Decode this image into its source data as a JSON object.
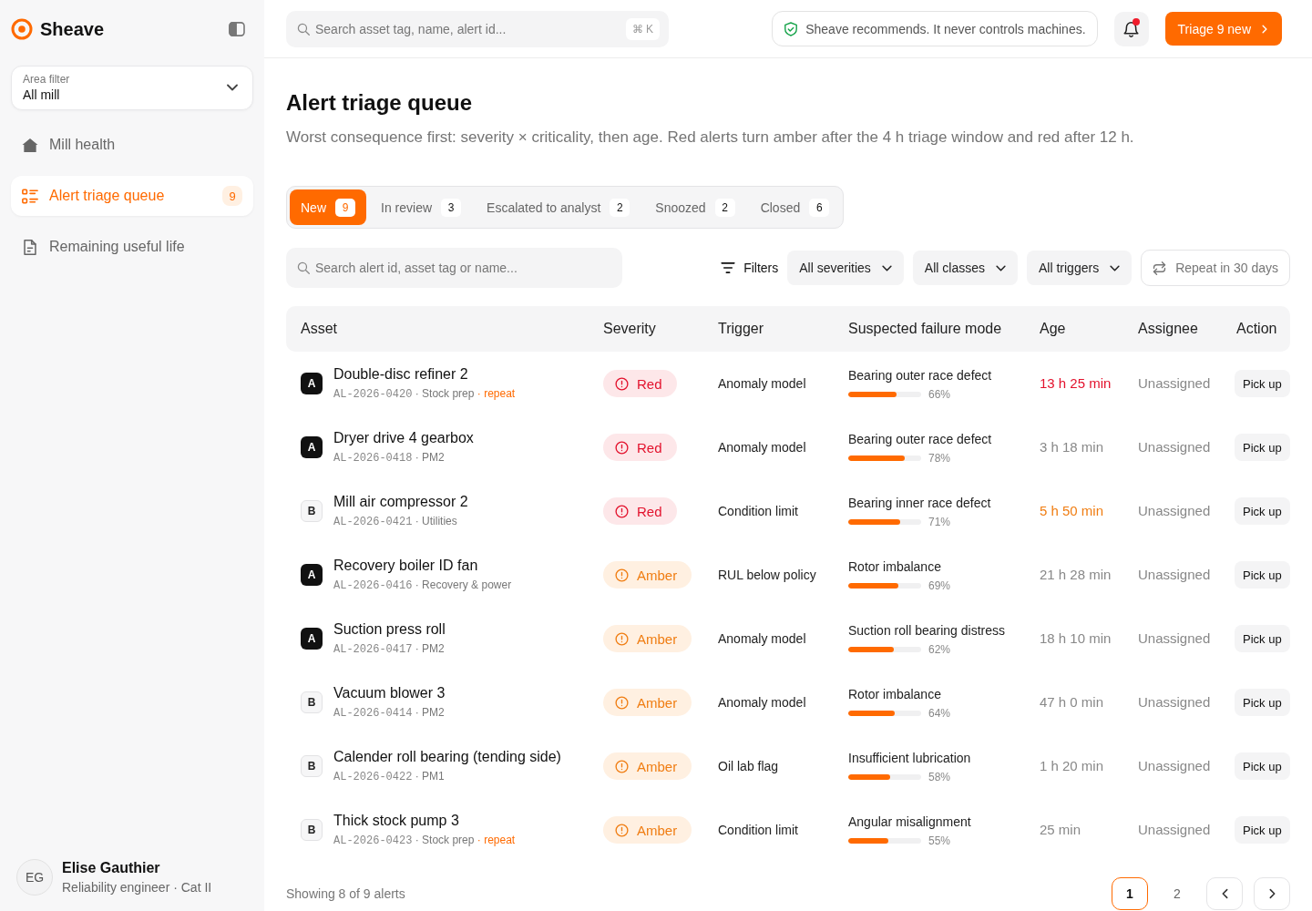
{
  "sidebar": {
    "brand": "Sheave",
    "area_filter": {
      "label": "Area filter",
      "value": "All mill"
    },
    "nav": [
      {
        "label": "Mill health",
        "selected": false
      },
      {
        "label": "Alert triage queue",
        "selected": true,
        "count": "9"
      },
      {
        "label": "Remaining useful life",
        "selected": false
      }
    ],
    "user": {
      "initials": "EG",
      "name": "Elise Gauthier",
      "role": "Reliability engineer · Cat II"
    }
  },
  "topbar": {
    "search": {
      "placeholder": "Search asset tag, name, alert id...",
      "shortcut": "⌘ K"
    },
    "notice": "Sheave recommends. It never controls machines.",
    "notifications": {
      "unread": true
    },
    "primary_action": "Triage 9 new"
  },
  "page": {
    "title": "Alert triage queue",
    "subtitle": "Worst consequence first: severity × criticality, then age. Red alerts turn amber after the 4 h triage window and red after 12 h."
  },
  "tabs": [
    {
      "label": "New",
      "count": "9",
      "selected": true
    },
    {
      "label": "In review",
      "count": "3",
      "selected": false
    },
    {
      "label": "Escalated to analyst",
      "count": "2",
      "selected": false
    },
    {
      "label": "Snoozed",
      "count": "2",
      "selected": false
    },
    {
      "label": "Closed",
      "count": "6",
      "selected": false
    }
  ],
  "filters": {
    "search": {
      "placeholder": "Search alert id, asset tag or name..."
    },
    "filter_button": "Filters",
    "dropdowns": [
      "All severities",
      "All classes",
      "All triggers"
    ],
    "repeat_toggle": {
      "label": "Repeat in 30 days",
      "on": false
    }
  },
  "table": {
    "columns": [
      "Asset",
      "Severity",
      "Trigger",
      "Suspected failure mode",
      "Age",
      "Assignee",
      "Action"
    ],
    "rows": [
      {
        "criticality": {
          "label": "A",
          "kind": "filled"
        },
        "name": "Double-disc refiner 2",
        "alert_id": "AL-2026-0420",
        "area": "· Stock prep",
        "flag": "· repeat",
        "severity": {
          "label": "Red",
          "kind": "red"
        },
        "trigger": "Anomaly model",
        "failure_mode": {
          "label": "Bearing outer race defect",
          "level": 0.66,
          "reading": "66%"
        },
        "age": {
          "text": "13 h 25 min",
          "kind": "overdue"
        },
        "assignee": "Unassigned",
        "action": "Pick up"
      },
      {
        "criticality": {
          "label": "A",
          "kind": "filled"
        },
        "name": "Dryer drive 4 gearbox",
        "alert_id": "AL-2026-0418",
        "area": "· PM2",
        "severity": {
          "label": "Red",
          "kind": "red"
        },
        "trigger": "Anomaly model",
        "failure_mode": {
          "label": "Bearing outer race defect",
          "level": 0.78,
          "reading": "78%"
        },
        "age": {
          "text": "3 h 18 min",
          "kind": "normal"
        },
        "assignee": "Unassigned",
        "action": "Pick up"
      },
      {
        "criticality": {
          "label": "B",
          "kind": "outlined"
        },
        "name": "Mill air compressor 2",
        "alert_id": "AL-2026-0421",
        "area": "· Utilities",
        "severity": {
          "label": "Red",
          "kind": "red"
        },
        "trigger": "Condition limit",
        "failure_mode": {
          "label": "Bearing inner race defect",
          "level": 0.71,
          "reading": "71%"
        },
        "age": {
          "text": "5 h 50 min",
          "kind": "due_soon"
        },
        "assignee": "Unassigned",
        "action": "Pick up"
      },
      {
        "criticality": {
          "label": "A",
          "kind": "filled"
        },
        "name": "Recovery boiler ID fan",
        "alert_id": "AL-2026-0416",
        "area": "· Recovery & power",
        "severity": {
          "label": "Amber",
          "kind": "amber"
        },
        "trigger": "RUL below policy",
        "failure_mode": {
          "label": "Rotor imbalance",
          "level": 0.69,
          "reading": "69%"
        },
        "age": {
          "text": "21 h 28 min",
          "kind": "normal"
        },
        "assignee": "Unassigned",
        "action": "Pick up"
      },
      {
        "criticality": {
          "label": "A",
          "kind": "filled"
        },
        "name": "Suction press roll",
        "alert_id": "AL-2026-0417",
        "area": "· PM2",
        "severity": {
          "label": "Amber",
          "kind": "amber"
        },
        "trigger": "Anomaly model",
        "failure_mode": {
          "label": "Suction roll bearing distress",
          "level": 0.62,
          "reading": "62%"
        },
        "age": {
          "text": "18 h 10 min",
          "kind": "normal"
        },
        "assignee": "Unassigned",
        "action": "Pick up"
      },
      {
        "criticality": {
          "label": "B",
          "kind": "outlined"
        },
        "name": "Vacuum blower 3",
        "alert_id": "AL-2026-0414",
        "area": "· PM2",
        "severity": {
          "label": "Amber",
          "kind": "amber"
        },
        "trigger": "Anomaly model",
        "failure_mode": {
          "label": "Rotor imbalance",
          "level": 0.64,
          "reading": "64%"
        },
        "age": {
          "text": "47 h 0 min",
          "kind": "normal"
        },
        "assignee": "Unassigned",
        "action": "Pick up"
      },
      {
        "criticality": {
          "label": "B",
          "kind": "outlined"
        },
        "name": "Calender roll bearing (tending side)",
        "alert_id": "AL-2026-0422",
        "area": "· PM1",
        "severity": {
          "label": "Amber",
          "kind": "amber"
        },
        "trigger": "Oil lab flag",
        "failure_mode": {
          "label": "Insufficient lubrication",
          "level": 0.58,
          "reading": "58%"
        },
        "age": {
          "text": "1 h 20 min",
          "kind": "normal"
        },
        "assignee": "Unassigned",
        "action": "Pick up"
      },
      {
        "criticality": {
          "label": "B",
          "kind": "outlined"
        },
        "name": "Thick stock pump 3",
        "alert_id": "AL-2026-0423",
        "area": "· Stock prep",
        "flag": "· repeat",
        "severity": {
          "label": "Amber",
          "kind": "amber"
        },
        "trigger": "Condition limit",
        "failure_mode": {
          "label": "Angular misalignment",
          "level": 0.55,
          "reading": "55%"
        },
        "age": {
          "text": "25 min",
          "kind": "normal"
        },
        "assignee": "Unassigned",
        "action": "Pick up"
      }
    ]
  },
  "footer": {
    "summary": "Showing 8 of 9 alerts",
    "pages": [
      {
        "label": "1",
        "selected": true
      },
      {
        "label": "2",
        "selected": false
      }
    ]
  }
}
